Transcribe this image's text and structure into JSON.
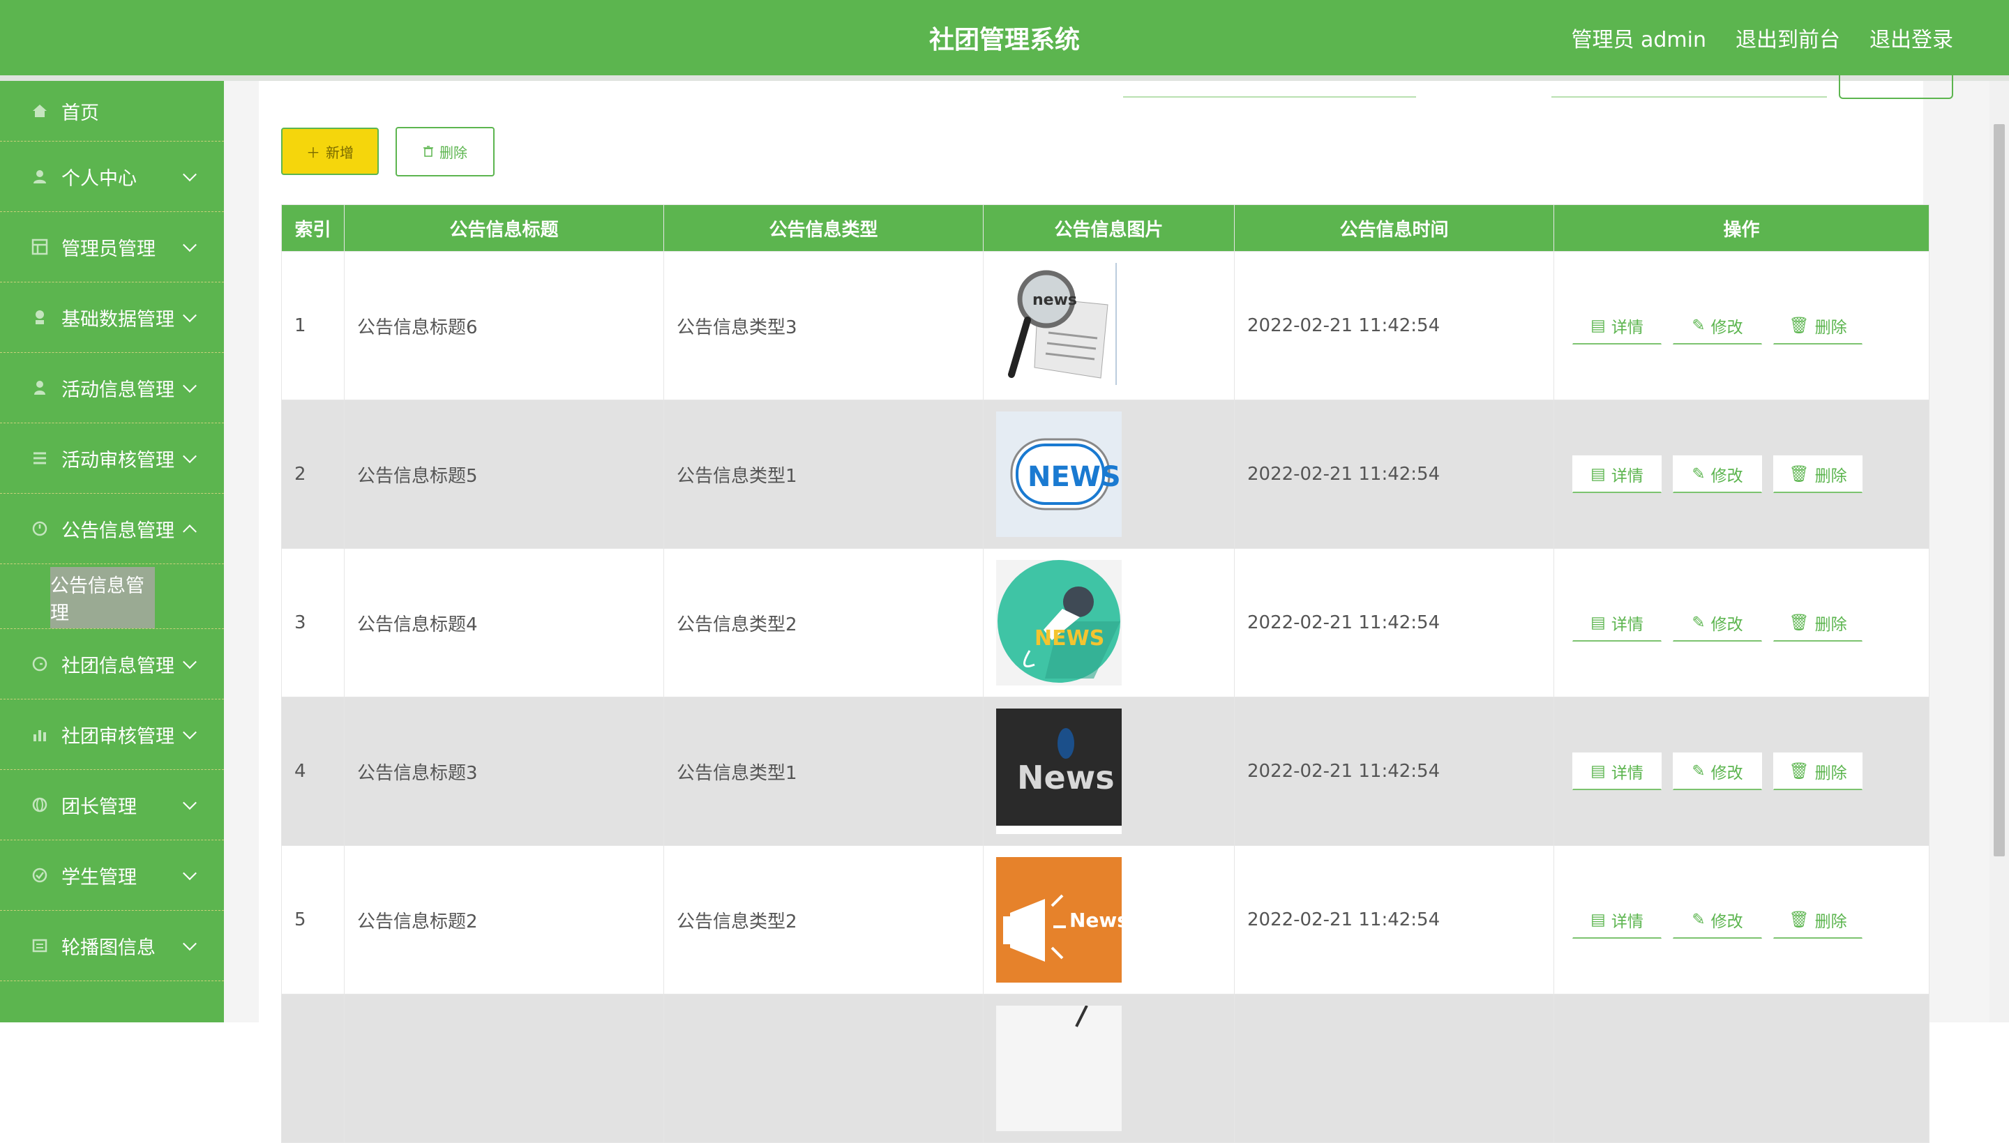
{
  "header": {
    "title": "社团管理系统",
    "user_label": "管理员 admin",
    "to_front": "退出到前台",
    "logout": "退出登录"
  },
  "sidebar": {
    "items": [
      {
        "label": "首页",
        "icon": "home-icon"
      },
      {
        "label": "个人中心",
        "icon": "person-icon"
      },
      {
        "label": "管理员管理",
        "icon": "grid-icon"
      },
      {
        "label": "基础数据管理",
        "icon": "data-icon"
      },
      {
        "label": "活动信息管理",
        "icon": "user-icon"
      },
      {
        "label": "活动审核管理",
        "icon": "list-icon"
      },
      {
        "label": "公告信息管理",
        "icon": "clock-icon"
      },
      {
        "label": "社团信息管理",
        "icon": "clock-icon"
      },
      {
        "label": "社团审核管理",
        "icon": "chart-icon"
      },
      {
        "label": "团长管理",
        "icon": "globe-icon"
      },
      {
        "label": "学生管理",
        "icon": "check-icon"
      },
      {
        "label": "轮播图信息",
        "icon": "list-icon"
      }
    ],
    "active_sub": "公告信息管理"
  },
  "toolbar": {
    "add_label": "新增",
    "delete_label": "删除"
  },
  "table": {
    "headers": [
      "索引",
      "公告信息标题",
      "公告信息类型",
      "公告信息图片",
      "公告信息时间",
      "操作"
    ],
    "rows": [
      {
        "index": "1",
        "title": "公告信息标题6",
        "type": "公告信息类型3",
        "time": "2022-02-21 11:42:54",
        "image": "news-magnifier"
      },
      {
        "index": "2",
        "title": "公告信息标题5",
        "type": "公告信息类型1",
        "time": "2022-02-21 11:42:54",
        "image": "news-button"
      },
      {
        "index": "3",
        "title": "公告信息标题4",
        "type": "公告信息类型2",
        "time": "2022-02-21 11:42:54",
        "image": "news-microphone"
      },
      {
        "index": "4",
        "title": "公告信息标题3",
        "type": "公告信息类型1",
        "time": "2022-02-21 11:42:54",
        "image": "news-dark-bird"
      },
      {
        "index": "5",
        "title": "公告信息标题2",
        "type": "公告信息类型2",
        "time": "2022-02-21 11:42:54",
        "image": "news-megaphone"
      },
      {
        "index": "",
        "title": "",
        "type": "",
        "time": "",
        "image": "partial"
      }
    ],
    "ops": {
      "detail": "详情",
      "edit": "修改",
      "delete": "删除"
    }
  },
  "colors": {
    "primary": "#5cb54f",
    "add_button": "#f5d60c",
    "row_alt": "#e2e2e2"
  }
}
